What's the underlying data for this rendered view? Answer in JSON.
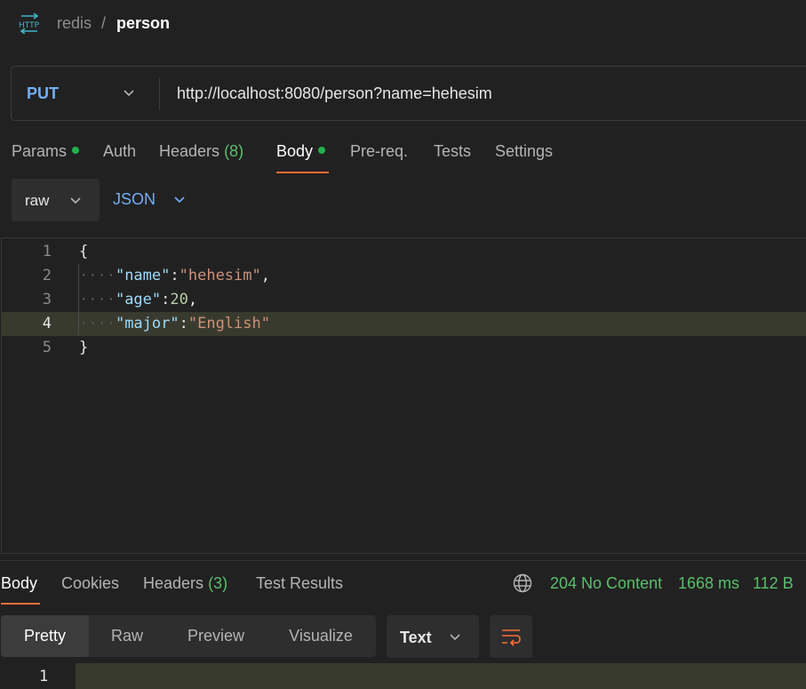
{
  "breadcrumb": {
    "collection": "redis",
    "separator": "/",
    "request": "person",
    "icon": "http-icon"
  },
  "request": {
    "method": "PUT",
    "url": "http://localhost:8080/person?name=hehesim"
  },
  "request_tabs": [
    {
      "label": "Params",
      "dot": true
    },
    {
      "label": "Auth"
    },
    {
      "label": "Headers",
      "count": "(8)"
    },
    {
      "label": "Body",
      "dot": true,
      "active": true
    },
    {
      "label": "Pre-req."
    },
    {
      "label": "Tests"
    },
    {
      "label": "Settings"
    }
  ],
  "body_mode": {
    "type": "raw",
    "language": "JSON"
  },
  "editor": {
    "line_numbers": [
      "1",
      "2",
      "3",
      "4",
      "5"
    ],
    "lines": [
      "{",
      "\"name\":\"hehesim\",",
      "\"age\":20,",
      "\"major\":\"English\"",
      "}"
    ],
    "current_line": 4
  },
  "response_tabs": [
    {
      "label": "Body",
      "active": true
    },
    {
      "label": "Cookies"
    },
    {
      "label": "Headers",
      "count": "(3)"
    },
    {
      "label": "Test Results"
    }
  ],
  "response_status": {
    "status": "204 No Content",
    "time": "1668 ms",
    "size": "112 B",
    "icon": "globe-icon"
  },
  "view_modes": [
    "Pretty",
    "Raw",
    "Preview",
    "Visualize"
  ],
  "active_view": "Pretty",
  "format": "Text",
  "response_editor": {
    "line_number": "1"
  },
  "colors": {
    "accent": "#ff6c37",
    "method": "#74aef6",
    "success": "#5bbf6b",
    "dot": "#22b14c"
  }
}
